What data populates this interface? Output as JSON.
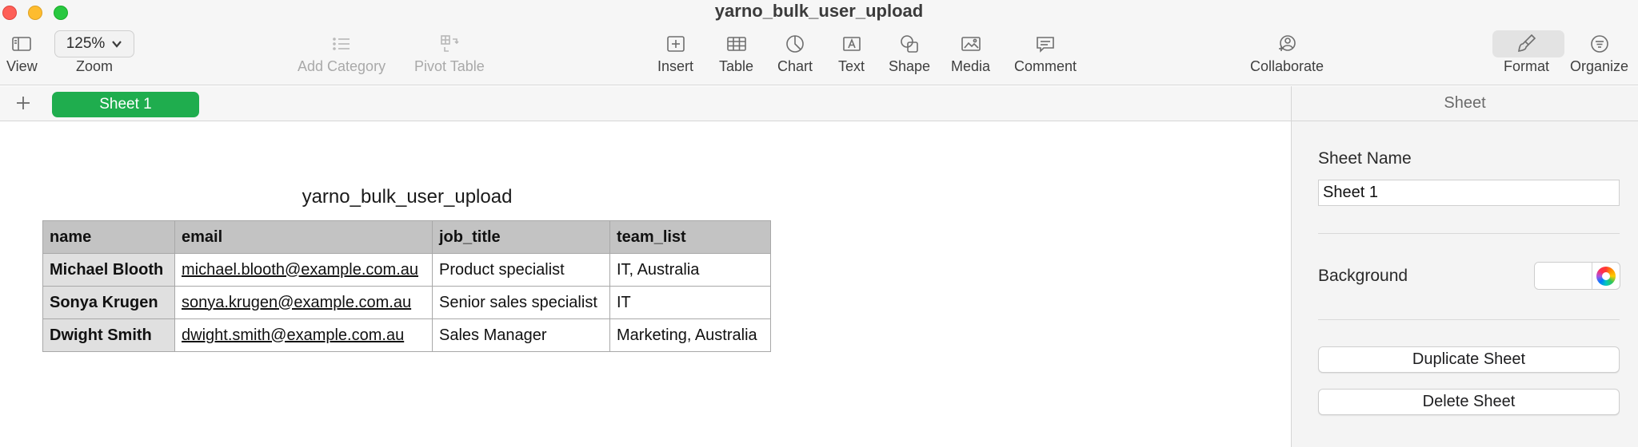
{
  "window": {
    "title": "yarno_bulk_user_upload"
  },
  "toolbar": {
    "view_label": "View",
    "zoom_value": "125%",
    "zoom_label": "Zoom",
    "add_category_label": "Add Category",
    "pivot_table_label": "Pivot Table",
    "insert_label": "Insert",
    "table_label": "Table",
    "chart_label": "Chart",
    "text_label": "Text",
    "shape_label": "Shape",
    "media_label": "Media",
    "comment_label": "Comment",
    "collaborate_label": "Collaborate",
    "format_label": "Format",
    "organize_label": "Organize"
  },
  "tabs": {
    "sheet1": "Sheet 1"
  },
  "table": {
    "title": "yarno_bulk_user_upload",
    "headers": [
      "name",
      "email",
      "job_title",
      "team_list"
    ],
    "rows": [
      [
        "Michael Blooth",
        "michael.blooth@example.com.au",
        "Product specialist",
        "IT, Australia"
      ],
      [
        "Sonya Krugen",
        "sonya.krugen@example.com.au",
        "Senior sales specialist",
        "IT"
      ],
      [
        "Dwight Smith",
        "dwight.smith@example.com.au",
        "Sales Manager",
        "Marketing, Australia"
      ]
    ]
  },
  "inspector": {
    "title": "Sheet",
    "sheet_name_label": "Sheet Name",
    "sheet_name_value": "Sheet 1",
    "background_label": "Background",
    "duplicate_label": "Duplicate Sheet",
    "delete_label": "Delete Sheet"
  },
  "colors": {
    "accent_tab": "#1fad4e",
    "header_fill": "#c3c3c3",
    "first_col_fill": "#e0e0e0"
  },
  "icons": {
    "view": "sidebar-icon",
    "zoom": "chevron-down-icon",
    "add_category": "list-icon",
    "pivot_table": "pivot-table-icon",
    "insert": "insert-icon",
    "table": "table-icon",
    "chart": "pie-chart-icon",
    "text": "text-box-icon",
    "shape": "shape-icon",
    "media": "photo-icon",
    "comment": "comment-icon",
    "collaborate": "collaborate-icon",
    "format": "paintbrush-icon",
    "organize": "organize-icon",
    "add_sheet": "plus-icon",
    "color_picker": "color-wheel-icon"
  }
}
